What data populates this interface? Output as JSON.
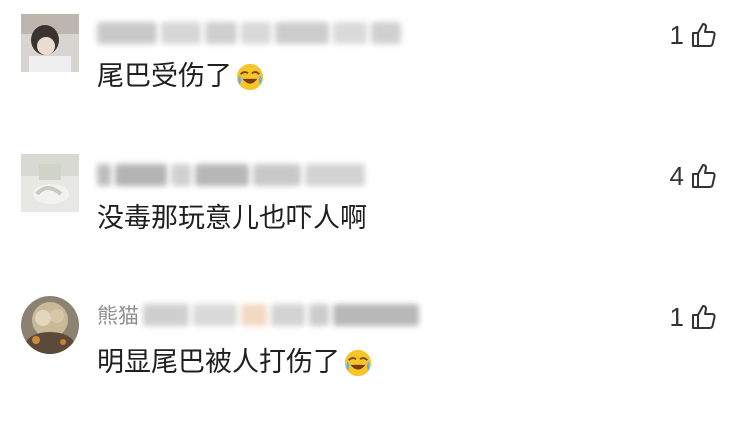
{
  "comments": [
    {
      "username_visible": "",
      "text": "尾巴受伤了",
      "emoji": "crying-laughing-emoji",
      "likes": "1",
      "thumb_icon": "thumbs-up-icon"
    },
    {
      "username_visible": "",
      "text": "没毒那玩意儿也吓人啊",
      "emoji": "",
      "likes": "4",
      "thumb_icon": "thumbs-up-icon"
    },
    {
      "username_visible": "熊猫",
      "text": "明显尾巴被人打伤了",
      "emoji": "crying-laughing-emoji",
      "likes": "1",
      "thumb_icon": "thumbs-up-icon"
    }
  ],
  "colors": {
    "text": "#1f1f1f",
    "meta": "#9a9a9a",
    "like": "#333333",
    "emoji_face": "#f7c52a"
  }
}
